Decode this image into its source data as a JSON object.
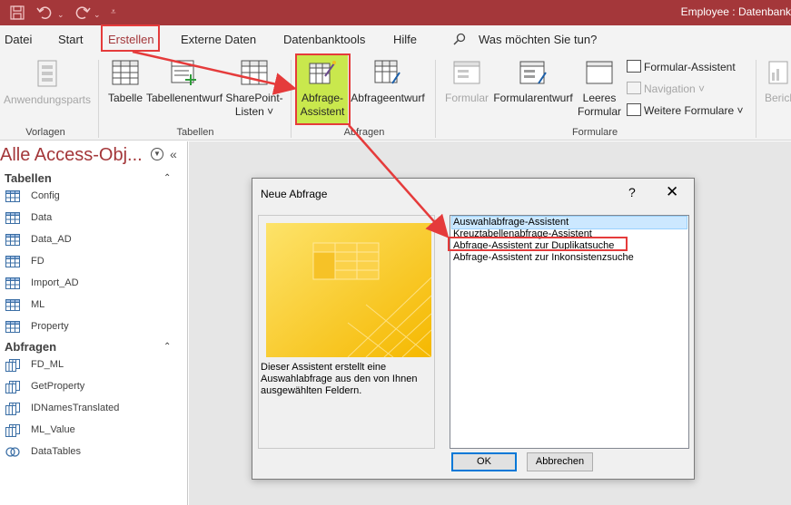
{
  "window": {
    "title": "Employee : Datenbank"
  },
  "quick_access": {
    "icons": [
      "save-icon",
      "undo-icon",
      "redo-icon",
      "customize-icon"
    ]
  },
  "tabs": [
    {
      "label": "Datei"
    },
    {
      "label": "Start"
    },
    {
      "label": "Erstellen",
      "active": true
    },
    {
      "label": "Externe Daten"
    },
    {
      "label": "Datenbanktools"
    },
    {
      "label": "Hilfe"
    }
  ],
  "search": {
    "label": "Was möchten Sie tun?"
  },
  "ribbon": {
    "vorlagen": {
      "button": "Anwendungsparts",
      "group": "Vorlagen"
    },
    "tabellen": {
      "buttons": [
        {
          "label": "Tabelle"
        },
        {
          "label": "Tabellenentwurf"
        },
        {
          "label": "SharePoint-",
          "label2": "Listen ˅"
        }
      ],
      "group": "Tabellen"
    },
    "abfragen": {
      "buttons": [
        {
          "label": "Abfrage-",
          "label2": "Assistent",
          "highlighted": true
        },
        {
          "label": "Abfrageentwurf"
        }
      ],
      "group": "Abfragen"
    },
    "formulare": {
      "buttons": [
        {
          "label": "Formular",
          "disabled": true
        },
        {
          "label": "Formularentwurf"
        },
        {
          "label": "Leeres",
          "label2": "Formular"
        }
      ],
      "small": [
        {
          "label": "Formular-Assistent",
          "disabled": false
        },
        {
          "label": "Navigation ˅",
          "disabled": true
        },
        {
          "label": "Weitere Formulare ˅",
          "disabled": false
        }
      ],
      "group": "Formulare"
    },
    "berichte": {
      "button": "Berich"
    }
  },
  "nav": {
    "title": "Alle Access-Obj...",
    "sections": [
      {
        "header": "Tabellen",
        "items": [
          "Config",
          "Data",
          "Data_AD",
          "FD",
          "Import_AD",
          "ML",
          "Property"
        ]
      },
      {
        "header": "Abfragen",
        "items": [
          "FD_ML",
          "GetProperty",
          "IDNamesTranslated",
          "ML_Value",
          "DataTables"
        ]
      }
    ]
  },
  "dialog": {
    "title": "Neue Abfrage",
    "help": "?",
    "close": "✕",
    "description": "Dieser Assistent erstellt eine Auswahlabfrage aus den von Ihnen ausgewählten Feldern.",
    "options": [
      {
        "label": "Auswahlabfrage-Assistent",
        "selected": true
      },
      {
        "label": "Kreuztabellenabfrage-Assistent"
      },
      {
        "label": "Abfrage-Assistent zur Duplikatsuche",
        "highlighted": true
      },
      {
        "label": "Abfrage-Assistent zur Inkonsistenzsuche"
      }
    ],
    "ok": "OK",
    "cancel": "Abbrechen"
  },
  "colors": {
    "accent": "#a4373a",
    "annotation": "#e53b3b",
    "highlight": "#c9e84d",
    "selection": "#cce8ff"
  }
}
